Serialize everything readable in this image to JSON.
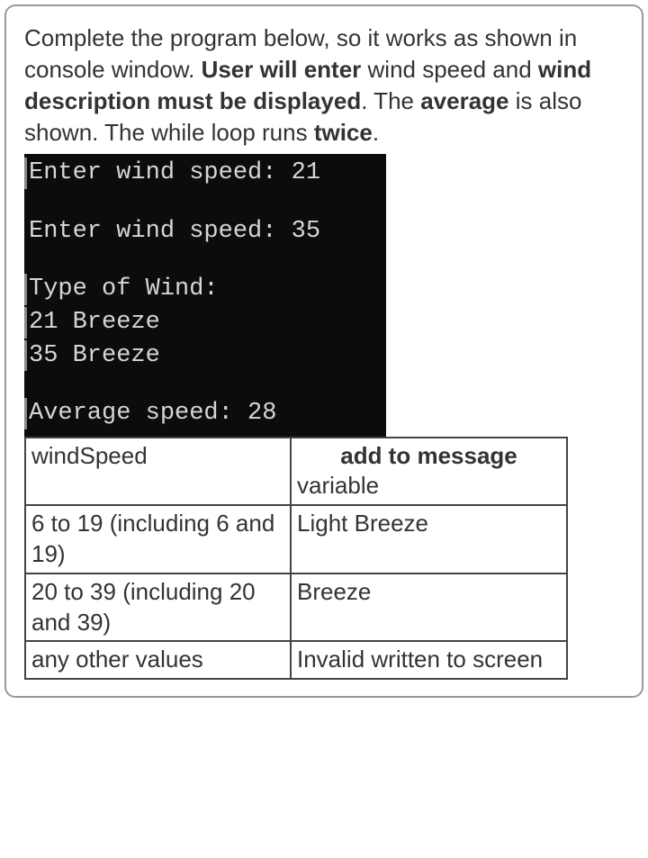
{
  "instructions": {
    "part1": "Complete the program below, so it works as shown in console window. ",
    "bold1": "User will enter",
    "part2": " wind speed and ",
    "bold2": "wind description must be displayed",
    "part3": ". The ",
    "bold3": "average",
    "part4": " is also shown. The while loop runs ",
    "bold4": "twice",
    "part5": "."
  },
  "console": {
    "line1": "Enter wind speed: 21",
    "line2": "Enter wind speed: 35",
    "line3": "Type of Wind:",
    "line4": "21 Breeze",
    "line5": "35 Breeze",
    "line6": "Average speed: 28"
  },
  "table": {
    "header": {
      "col1": "windSpeed",
      "col2_bold": "add to message",
      "col2_rest": "variable"
    },
    "rows": [
      {
        "range": "6 to 19 (including 6 and 19)",
        "msg": "Light Breeze"
      },
      {
        "range": "20 to 39 (including 20 and 39)",
        "msg": "Breeze"
      },
      {
        "range": "any other values",
        "msg": "Invalid written to screen"
      }
    ]
  }
}
